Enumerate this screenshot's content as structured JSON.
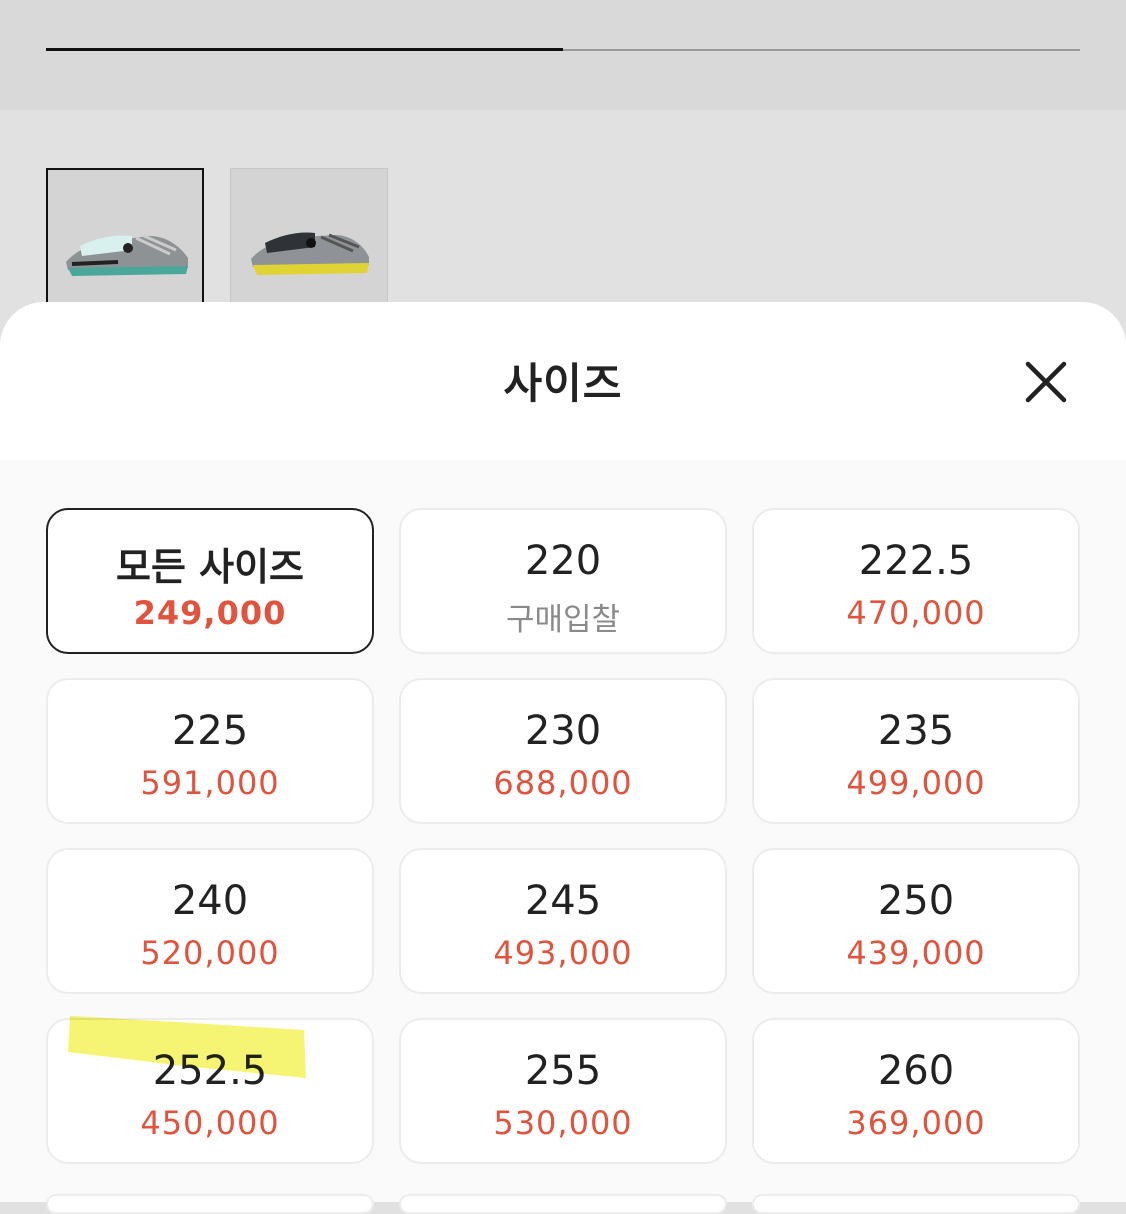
{
  "gallery": {
    "progress_fraction": 0.5,
    "thumbnails": [
      {
        "name": "mint-gray-sneaker-thumbnail",
        "selected": true
      },
      {
        "name": "yellow-gray-sneaker-thumbnail",
        "selected": false
      }
    ]
  },
  "sheet": {
    "title": "사이즈",
    "close_icon": "close-icon"
  },
  "sizes": [
    {
      "label": "모든 사이즈",
      "price": "249,000",
      "selected": true
    },
    {
      "label": "220",
      "price": "구매입찰",
      "muted": true
    },
    {
      "label": "222.5",
      "price": "470,000"
    },
    {
      "label": "225",
      "price": "591,000"
    },
    {
      "label": "230",
      "price": "688,000"
    },
    {
      "label": "235",
      "price": "499,000"
    },
    {
      "label": "240",
      "price": "520,000"
    },
    {
      "label": "245",
      "price": "493,000"
    },
    {
      "label": "250",
      "price": "439,000"
    },
    {
      "label": "252.5",
      "price": "450,000",
      "highlighted": true
    },
    {
      "label": "255",
      "price": "530,000"
    },
    {
      "label": "260",
      "price": "369,000"
    }
  ],
  "colors": {
    "price": "#e0543f",
    "muted": "#8a8a8a",
    "highlighter": "#f3f35a"
  }
}
